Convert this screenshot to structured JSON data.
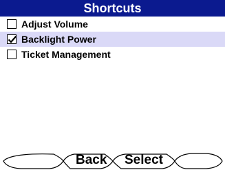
{
  "title": "Shortcuts",
  "items": [
    {
      "label": "Adjust Volume",
      "checked": false,
      "highlighted": false
    },
    {
      "label": "Backlight Power",
      "checked": true,
      "highlighted": true
    },
    {
      "label": "Ticket Management",
      "checked": false,
      "highlighted": false
    }
  ],
  "softkeys": {
    "left": "",
    "back": "Back",
    "select": "Select",
    "right": ""
  },
  "colors": {
    "title_background": "#0b1a8f",
    "highlight": "#dad9f7"
  }
}
